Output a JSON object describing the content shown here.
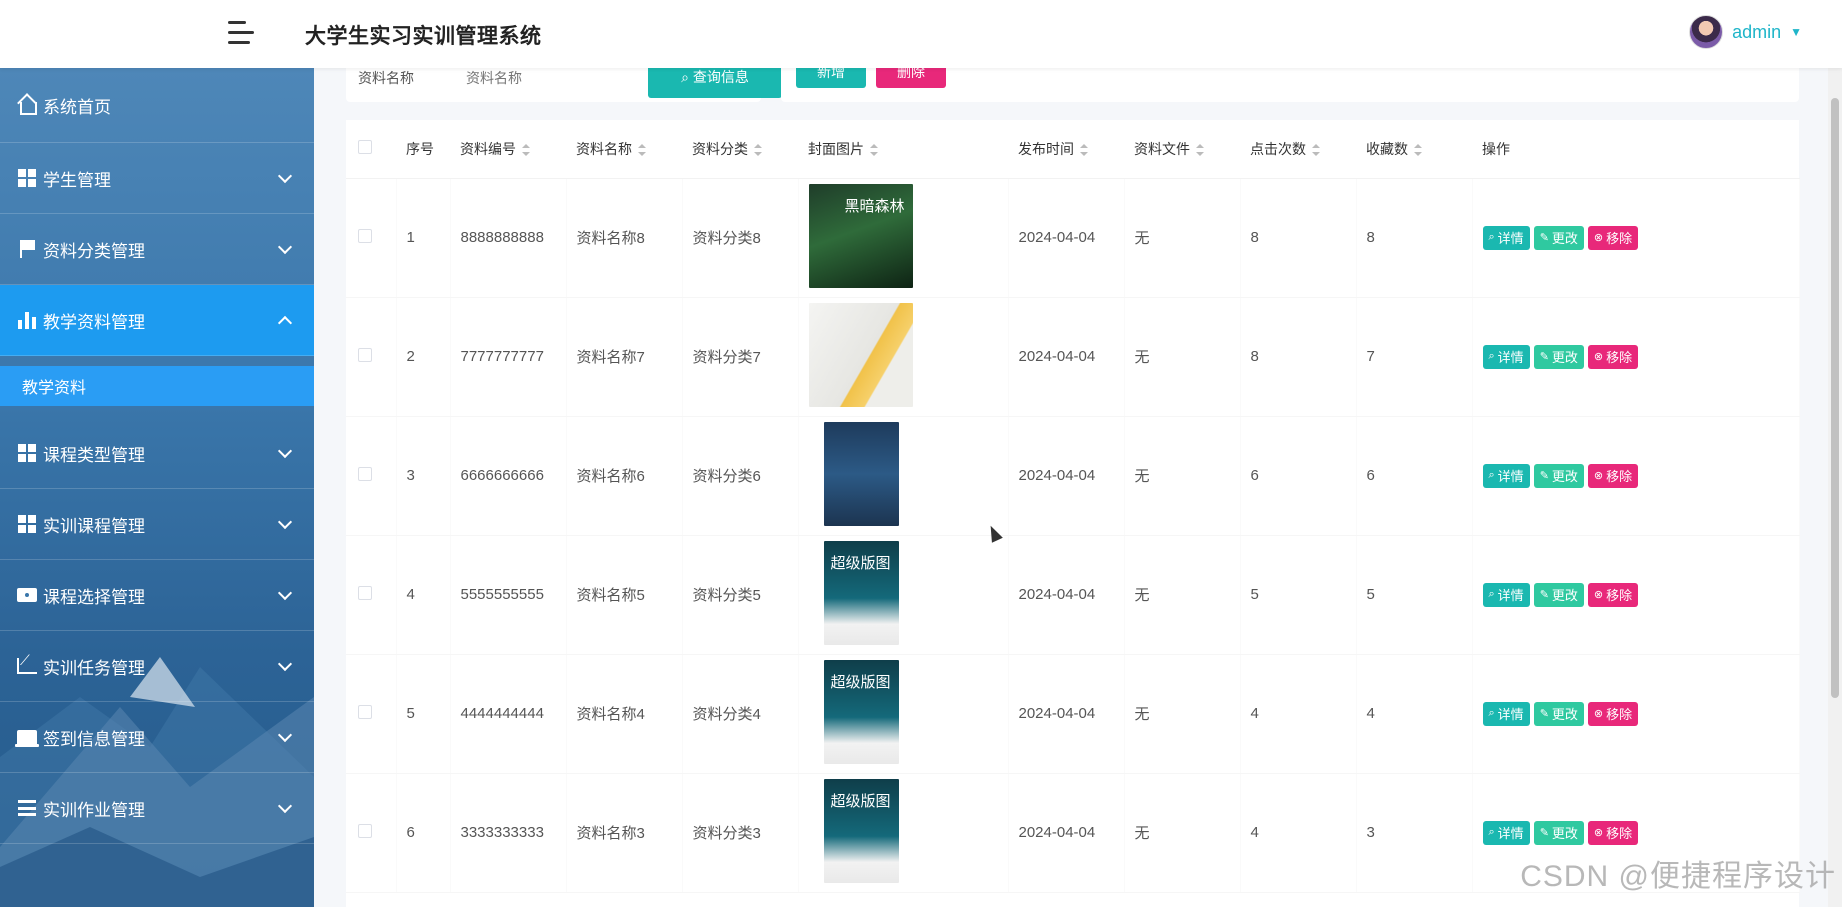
{
  "app": {
    "title": "大学生实习实训管理系统"
  },
  "user": {
    "name": "admin"
  },
  "sidebar": {
    "items": [
      {
        "label": "系统首页",
        "icon": "home-icon"
      },
      {
        "label": "学生管理",
        "icon": "grid-icon"
      },
      {
        "label": "资料分类管理",
        "icon": "flag-icon"
      },
      {
        "label": "教学资料管理",
        "icon": "bar-chart-icon"
      },
      {
        "label": "课程类型管理",
        "icon": "grid-icon"
      },
      {
        "label": "实训课程管理",
        "icon": "grid-icon"
      },
      {
        "label": "课程选择管理",
        "icon": "ticket-icon"
      },
      {
        "label": "实训任务管理",
        "icon": "trend-icon"
      },
      {
        "label": "签到信息管理",
        "icon": "laptop-icon"
      },
      {
        "label": "实训作业管理",
        "icon": "list-icon"
      }
    ],
    "submenu": {
      "label": "教学资料"
    }
  },
  "search": {
    "label": "资料名称",
    "placeholder": "资料名称",
    "button_label": "查询信息"
  },
  "toolbar": {
    "add_label": "新增",
    "delete_label": "删除"
  },
  "table": {
    "headers": [
      "序号",
      "资料编号",
      "资料名称",
      "资料分类",
      "封面图片",
      "发布时间",
      "资料文件",
      "点击次数",
      "收藏数",
      "操作"
    ],
    "rows": [
      {
        "index": "1",
        "code": "8888888888",
        "name": "资料名称8",
        "category": "资料分类8",
        "date": "2024-04-04",
        "file": "无",
        "clicks": "8",
        "favorites": "8",
        "cover_text": "黑暗森林"
      },
      {
        "index": "2",
        "code": "7777777777",
        "name": "资料名称7",
        "category": "资料分类7",
        "date": "2024-04-04",
        "file": "无",
        "clicks": "8",
        "favorites": "7",
        "cover_text": ""
      },
      {
        "index": "3",
        "code": "6666666666",
        "name": "资料名称6",
        "category": "资料分类6",
        "date": "2024-04-04",
        "file": "无",
        "clicks": "6",
        "favorites": "6",
        "cover_text": ""
      },
      {
        "index": "4",
        "code": "5555555555",
        "name": "资料名称5",
        "category": "资料分类5",
        "date": "2024-04-04",
        "file": "无",
        "clicks": "5",
        "favorites": "5",
        "cover_text": "超级版图"
      },
      {
        "index": "5",
        "code": "4444444444",
        "name": "资料名称4",
        "category": "资料分类4",
        "date": "2024-04-04",
        "file": "无",
        "clicks": "4",
        "favorites": "4",
        "cover_text": "超级版图"
      },
      {
        "index": "6",
        "code": "3333333333",
        "name": "资料名称3",
        "category": "资料分类3",
        "date": "2024-04-04",
        "file": "无",
        "clicks": "4",
        "favorites": "3",
        "cover_text": "超级版图"
      }
    ],
    "ops": {
      "detail": "详情",
      "edit": "更改",
      "remove": "移除"
    }
  },
  "watermark": "CSDN @便捷程序设计",
  "colors": {
    "accent": "#1ab8b0",
    "danger": "#e8287a",
    "sidebar_active": "#1d9bf0",
    "link": "#1fb5c9"
  }
}
